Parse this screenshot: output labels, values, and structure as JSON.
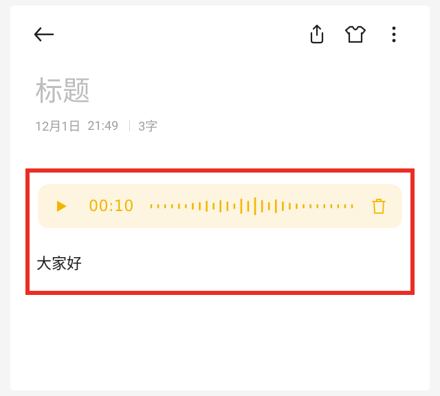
{
  "title_placeholder": "标题",
  "meta": {
    "date": "12月1日",
    "time": "21:49",
    "char_count": "3字"
  },
  "audio": {
    "duration": "00:10"
  },
  "body_text": "大家好",
  "colors": {
    "accent": "#f2b500",
    "highlight": "#ec2d24",
    "audio_bg": "#fdf5df"
  }
}
